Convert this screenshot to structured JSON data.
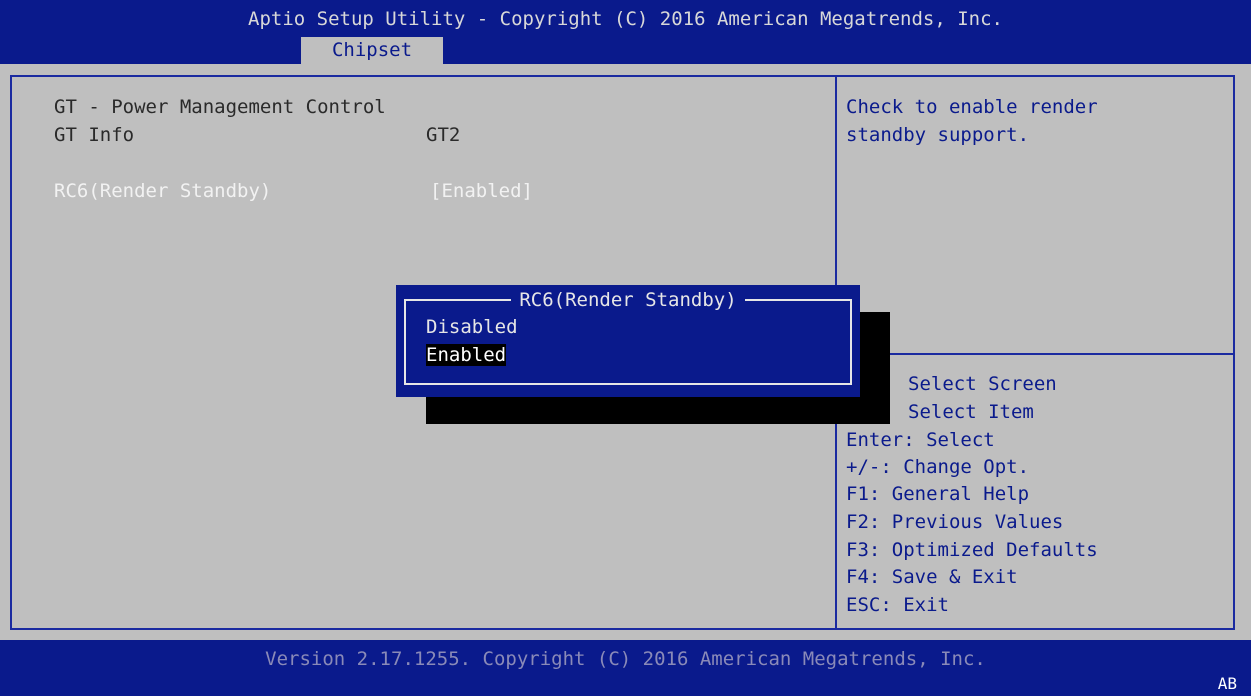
{
  "header": {
    "title": "Aptio Setup Utility - Copyright (C) 2016 American Megatrends, Inc.",
    "active_tab": "Chipset"
  },
  "left_panel": {
    "section_title": "GT - Power Management Control",
    "gt_info_label": "GT Info",
    "gt_info_value": "GT2",
    "rc6_label": "RC6(Render Standby)",
    "rc6_value": "[Enabled]"
  },
  "help_panel": {
    "lines": [
      "Check to enable render",
      "standby support."
    ]
  },
  "key_help": {
    "items": [
      "Select Screen",
      "Select Item",
      "Enter: Select",
      "+/-: Change Opt.",
      "F1: General Help",
      "F2: Previous Values",
      "F3: Optimized Defaults",
      "F4: Save & Exit",
      "ESC: Exit"
    ]
  },
  "popup": {
    "title": "RC6(Render Standby)",
    "options": [
      "Disabled",
      "Enabled"
    ],
    "selected": "Enabled"
  },
  "footer": {
    "version": "Version 2.17.1255. Copyright (C) 2016 American Megatrends, Inc.",
    "badge": "AB"
  },
  "colors": {
    "bar_blue": "#0a1a8c",
    "panel_grey": "#bfbfbf",
    "highlight_white": "#f2f2f2"
  }
}
